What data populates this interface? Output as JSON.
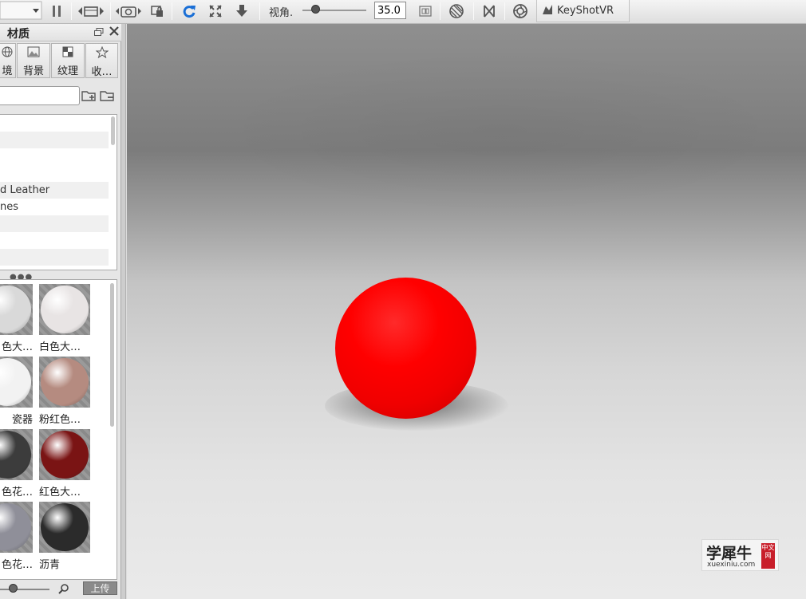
{
  "toolbar": {
    "fov_label": "视角.",
    "fov_value": "35.0",
    "fov_slider_fraction": 0.2,
    "vr_label": "KeyShotVR"
  },
  "panel": {
    "title": "材质",
    "tabs": [
      {
        "label": "境",
        "icon": "globe-icon"
      },
      {
        "label": "背景",
        "icon": "image-icon"
      },
      {
        "label": "纹理",
        "icon": "checker-icon"
      },
      {
        "label": "收…",
        "icon": "star-icon"
      }
    ],
    "search_placeholder": "",
    "tree_rows": [
      {
        "text": ""
      },
      {
        "text": ""
      },
      {
        "text": ""
      },
      {
        "text": ""
      },
      {
        "text": "d Leather"
      },
      {
        "text": "nes"
      },
      {
        "text": ""
      },
      {
        "text": ""
      },
      {
        "text": ""
      },
      {
        "text": ""
      }
    ],
    "materials": [
      {
        "caption": "色大…",
        "color": "#d9d9d9"
      },
      {
        "caption": "白色大…",
        "color": "#e8e4e4"
      },
      {
        "caption": "瓷器",
        "color": "#f2f2f2"
      },
      {
        "caption": "粉红色…",
        "color": "#b58b80"
      },
      {
        "caption": "色花…",
        "color": "#3c3c3c"
      },
      {
        "caption": "红色大…",
        "color": "#7a1414"
      },
      {
        "caption": "色花…",
        "color": "#8f8f99"
      },
      {
        "caption": "沥青",
        "color": "#2b2b2b"
      }
    ],
    "zoom_fraction": 0.25,
    "upload_label": "上传"
  },
  "viewport": {
    "sphere_color": "#ff0000"
  },
  "watermark": {
    "cn": "学犀牛",
    "en": "xuexiniu.com",
    "badge": "中文网"
  }
}
